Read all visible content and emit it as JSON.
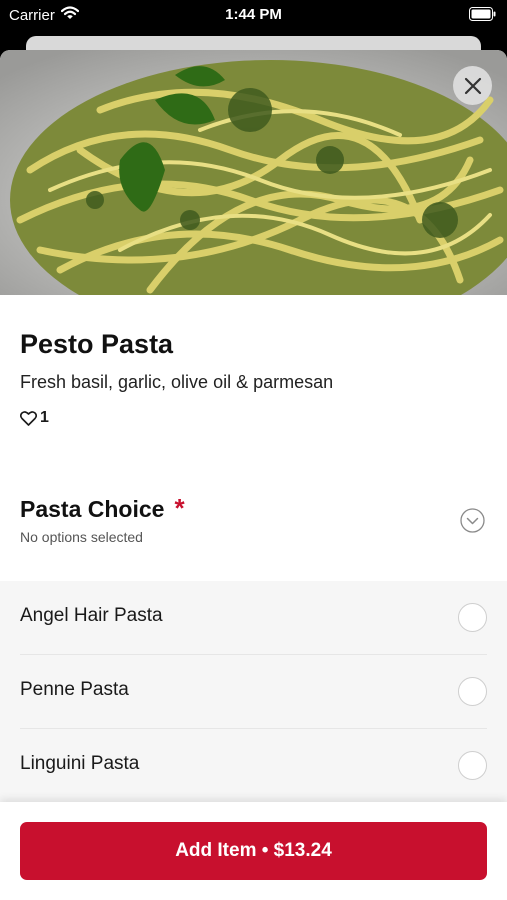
{
  "status_bar": {
    "carrier": "Carrier",
    "time": "1:44 PM"
  },
  "item": {
    "name": "Pesto Pasta",
    "description": "Fresh basil, garlic, olive oil & parmesan",
    "likes": "1",
    "image_alt": "pesto-pasta-photo"
  },
  "section": {
    "title": "Pasta Choice",
    "required_mark": "*",
    "subtitle": "No options selected"
  },
  "options": [
    {
      "label": "Angel Hair Pasta",
      "selected": false
    },
    {
      "label": "Penne Pasta",
      "selected": false
    },
    {
      "label": "Linguini Pasta",
      "selected": false
    }
  ],
  "footer": {
    "button_label": "Add Item • $13.24"
  },
  "colors": {
    "accent": "#c8102e"
  }
}
